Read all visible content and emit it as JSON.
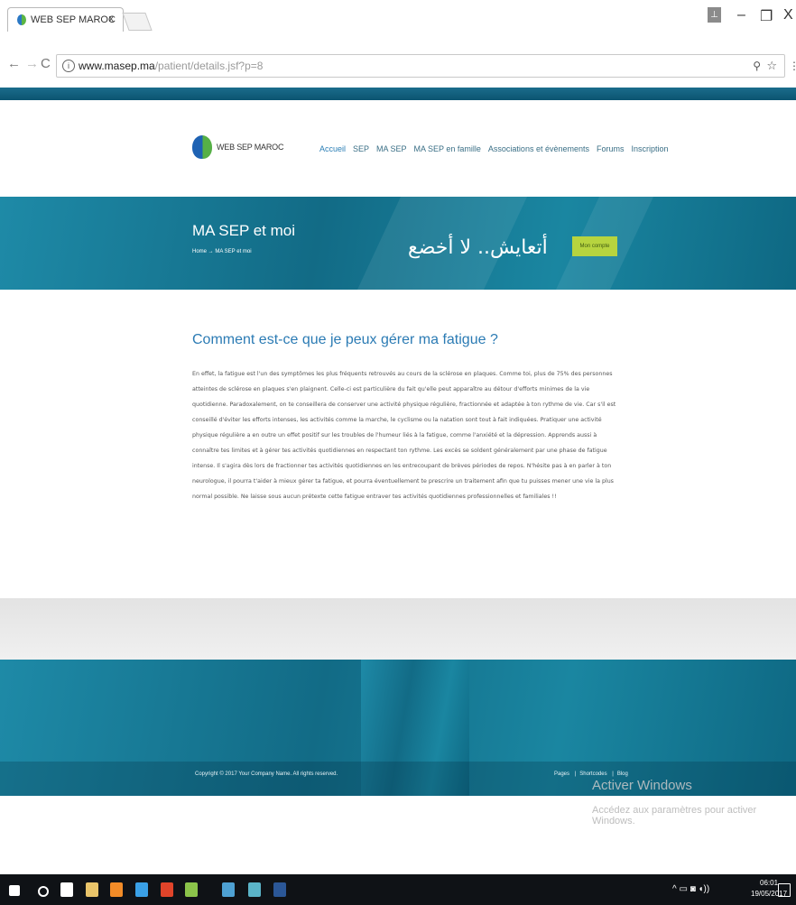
{
  "browser": {
    "tab_title": "WEB SEP MAROC",
    "tab_close": "x",
    "url_host": "www.masep.ma",
    "url_path": "/patient/details.jsf?p=8",
    "zoom_icon": "zoom-icon",
    "window_buttons": {
      "minimize": "–",
      "maximize": "❐",
      "close": "X"
    }
  },
  "site": {
    "logo_text": "WEB SEP MAROC",
    "nav": [
      "Accueil",
      "SEP",
      "MA SEP",
      "MA SEP en famille",
      "Associations et évènements",
      "Forums",
      "Inscription"
    ],
    "banner_title": "MA SEP et moi",
    "breadcrumb": "Home → MA SEP et moi",
    "slogan": "أتعايش.. لا أخضع",
    "account_button": "Mon compte"
  },
  "article": {
    "title": "Comment est-ce que je peux gérer ma fatigue ?",
    "body": "En effet, la fatigue est l'un des symptômes les plus fréquents retrouvés au cours de la sclérose en plaques. Comme toi, plus de 75% des personnes atteintes de sclérose en plaques s'en plaignent. Celle-ci est particulière du fait qu'elle peut apparaître au détour d'efforts minimes de la vie quotidienne. Paradoxalement, on te conseillera de conserver une activité physique régulière, fractionnée et adaptée à ton rythme de vie. Car s'il est conseillé d'éviter les efforts intenses, les activités comme la marche, le cyclisme ou la natation sont tout à fait indiquées. Pratiquer une activité physique régulière a en outre un effet positif sur les troubles de l'humeur liés à la fatigue, comme l'anxiété et la dépression. Apprends aussi à connaître tes limites et à gérer tes activités quotidiennes en respectant ton rythme. Les excès se soldent généralement par une phase de fatigue intense. Il s'agira dès lors de fractionner tes activités quotidiennes en les entrecoupant de brèves périodes de repos. N'hésite pas à en parler à ton neurologue, il pourra t'aider à mieux gérer ta fatigue, et pourra éventuellement te prescrire un traitement afin que tu puisses mener une vie la plus normal possible. Ne laisse sous aucun prétexte cette fatigue entraver tes activités quotidiennes professionnelles et familiales !!"
  },
  "footer": {
    "copyright": "Copyright © 2017 Your Company Name. All rights reserved.",
    "links": [
      "Pages",
      "Shortcodes",
      "Blog"
    ]
  },
  "os": {
    "activate_title": "Activer Windows",
    "activate_sub": "Accédez aux paramètres pour activer Windows.",
    "time": "06:01",
    "date": "19/05/2017"
  },
  "colors": {
    "banner_teal": "#1a86a1",
    "accent_blue": "#2b7bb4",
    "button_green": "#b7d43f"
  }
}
